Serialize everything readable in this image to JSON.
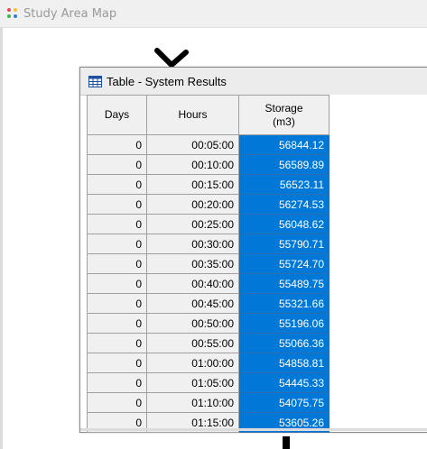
{
  "background_window": {
    "title": "Study Area Map"
  },
  "table_window": {
    "title": "Table - System Results",
    "columns": [
      {
        "label": "Days"
      },
      {
        "label": "Hours"
      },
      {
        "label": "Storage\n(m3)"
      }
    ],
    "rows": [
      {
        "days": "0",
        "hours": "00:05:00",
        "storage": "56844.12"
      },
      {
        "days": "0",
        "hours": "00:10:00",
        "storage": "56589.89"
      },
      {
        "days": "0",
        "hours": "00:15:00",
        "storage": "56523.11"
      },
      {
        "days": "0",
        "hours": "00:20:00",
        "storage": "56274.53"
      },
      {
        "days": "0",
        "hours": "00:25:00",
        "storage": "56048.62"
      },
      {
        "days": "0",
        "hours": "00:30:00",
        "storage": "55790.71"
      },
      {
        "days": "0",
        "hours": "00:35:00",
        "storage": "55724.70"
      },
      {
        "days": "0",
        "hours": "00:40:00",
        "storage": "55489.75"
      },
      {
        "days": "0",
        "hours": "00:45:00",
        "storage": "55321.66"
      },
      {
        "days": "0",
        "hours": "00:50:00",
        "storage": "55196.06"
      },
      {
        "days": "0",
        "hours": "00:55:00",
        "storage": "55066.36"
      },
      {
        "days": "0",
        "hours": "01:00:00",
        "storage": "54858.81"
      },
      {
        "days": "0",
        "hours": "01:05:00",
        "storage": "54445.33"
      },
      {
        "days": "0",
        "hours": "01:10:00",
        "storage": "54075.75"
      },
      {
        "days": "0",
        "hours": "01:15:00",
        "storage": "53605.26"
      }
    ]
  },
  "colors": {
    "selection": "#0078d7",
    "header_bg": "#f0f0f0"
  }
}
